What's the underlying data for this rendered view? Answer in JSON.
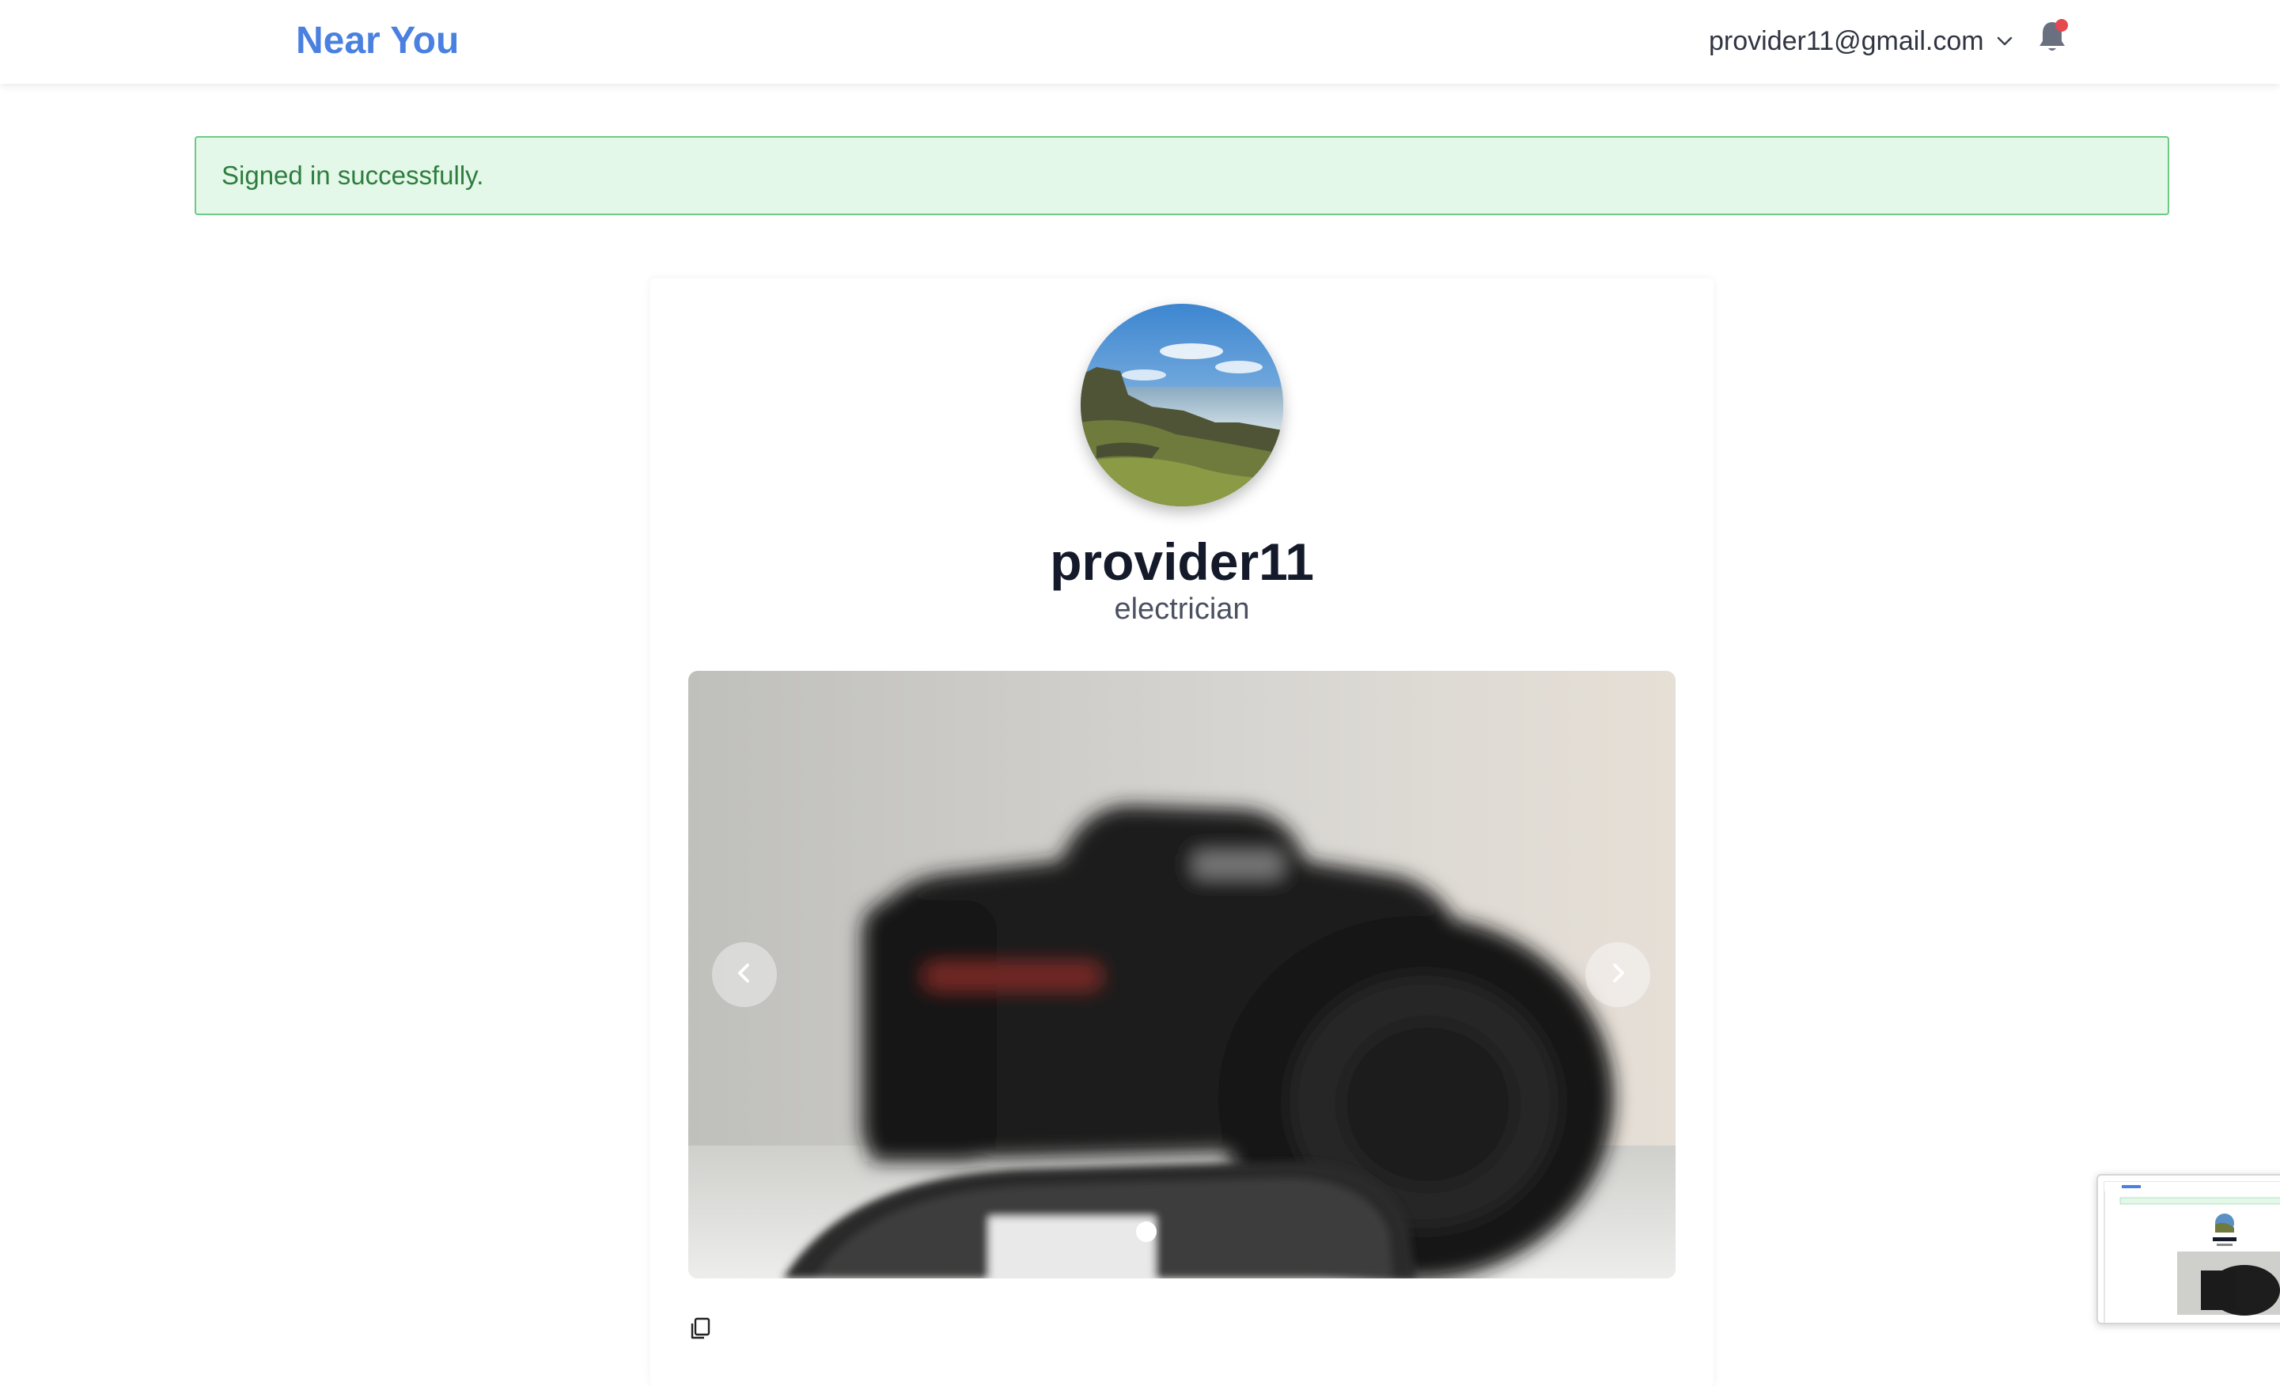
{
  "header": {
    "brand": "Near You",
    "user_email": "provider11@gmail.com",
    "icons": {
      "user_menu": "chevron-down-icon",
      "notifications": "bell-icon"
    },
    "colors": {
      "brand": "#4a80e0",
      "notification_dot": "#e5484d"
    }
  },
  "flash": {
    "message": "Signed in successfully.",
    "colors": {
      "background": "#e3f8e8",
      "border": "#6fc986",
      "text": "#2e7d3e"
    }
  },
  "profile": {
    "name": "provider11",
    "profession": "electrician"
  },
  "carousel": {
    "total_slides": 1,
    "active_slide": 1,
    "prev_icon": "chevron-left-icon",
    "next_icon": "chevron-right-icon"
  },
  "actions": {
    "copy_icon": "copy-icon"
  }
}
